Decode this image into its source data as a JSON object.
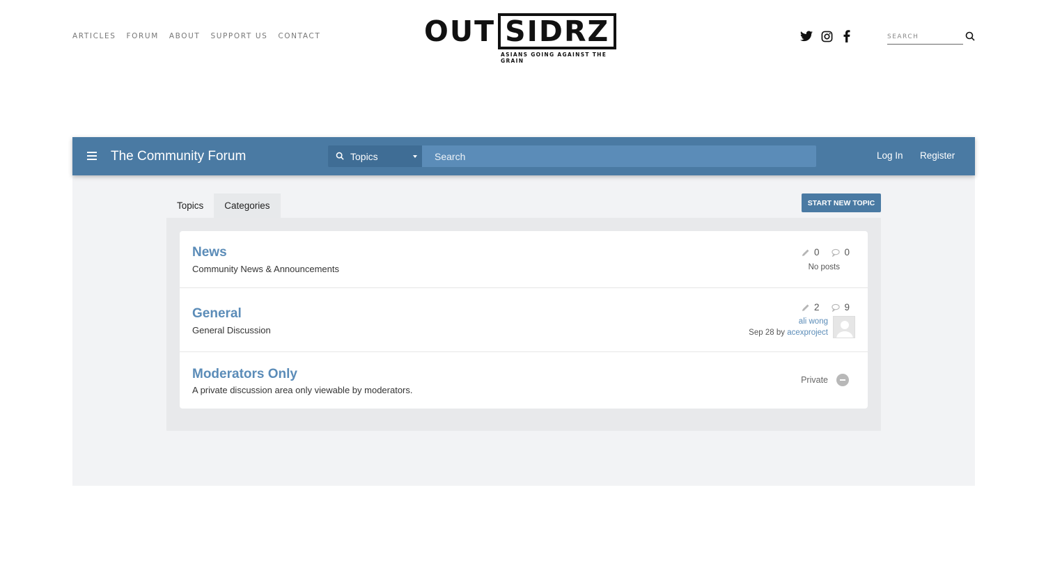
{
  "site": {
    "nav": [
      "ARTICLES",
      "FORUM",
      "ABOUT",
      "SUPPORT US",
      "CONTACT"
    ],
    "logo": {
      "out": "OUT",
      "boxed": "SIDRZ",
      "tagline": "ASIANS GOING AGAINST THE GRAIN"
    },
    "social_icons": [
      "twitter-icon",
      "instagram-icon",
      "facebook-icon"
    ],
    "search_placeholder": "SEARCH"
  },
  "forum": {
    "title": "The Community Forum",
    "search_scope": "Topics",
    "search_placeholder": "Search",
    "login_label": "Log In",
    "register_label": "Register",
    "tabs": [
      {
        "label": "Topics",
        "active": false
      },
      {
        "label": "Categories",
        "active": true
      }
    ],
    "new_topic_label": "START NEW TOPIC",
    "accent_color": "#4a7aa3",
    "link_color": "#5b8cb8",
    "categories": [
      {
        "name": "News",
        "description": "Community News & Announcements",
        "topics": "0",
        "posts": "0",
        "last_post": "No posts"
      },
      {
        "name": "General",
        "description": "General Discussion",
        "topics": "2",
        "posts": "9",
        "last_user": "ali wong",
        "last_date": "Sep 28",
        "last_by_word": "by",
        "last_by": "acexproject"
      },
      {
        "name": "Moderators Only",
        "description": "A private discussion area only viewable by moderators.",
        "status": "Private"
      }
    ]
  }
}
